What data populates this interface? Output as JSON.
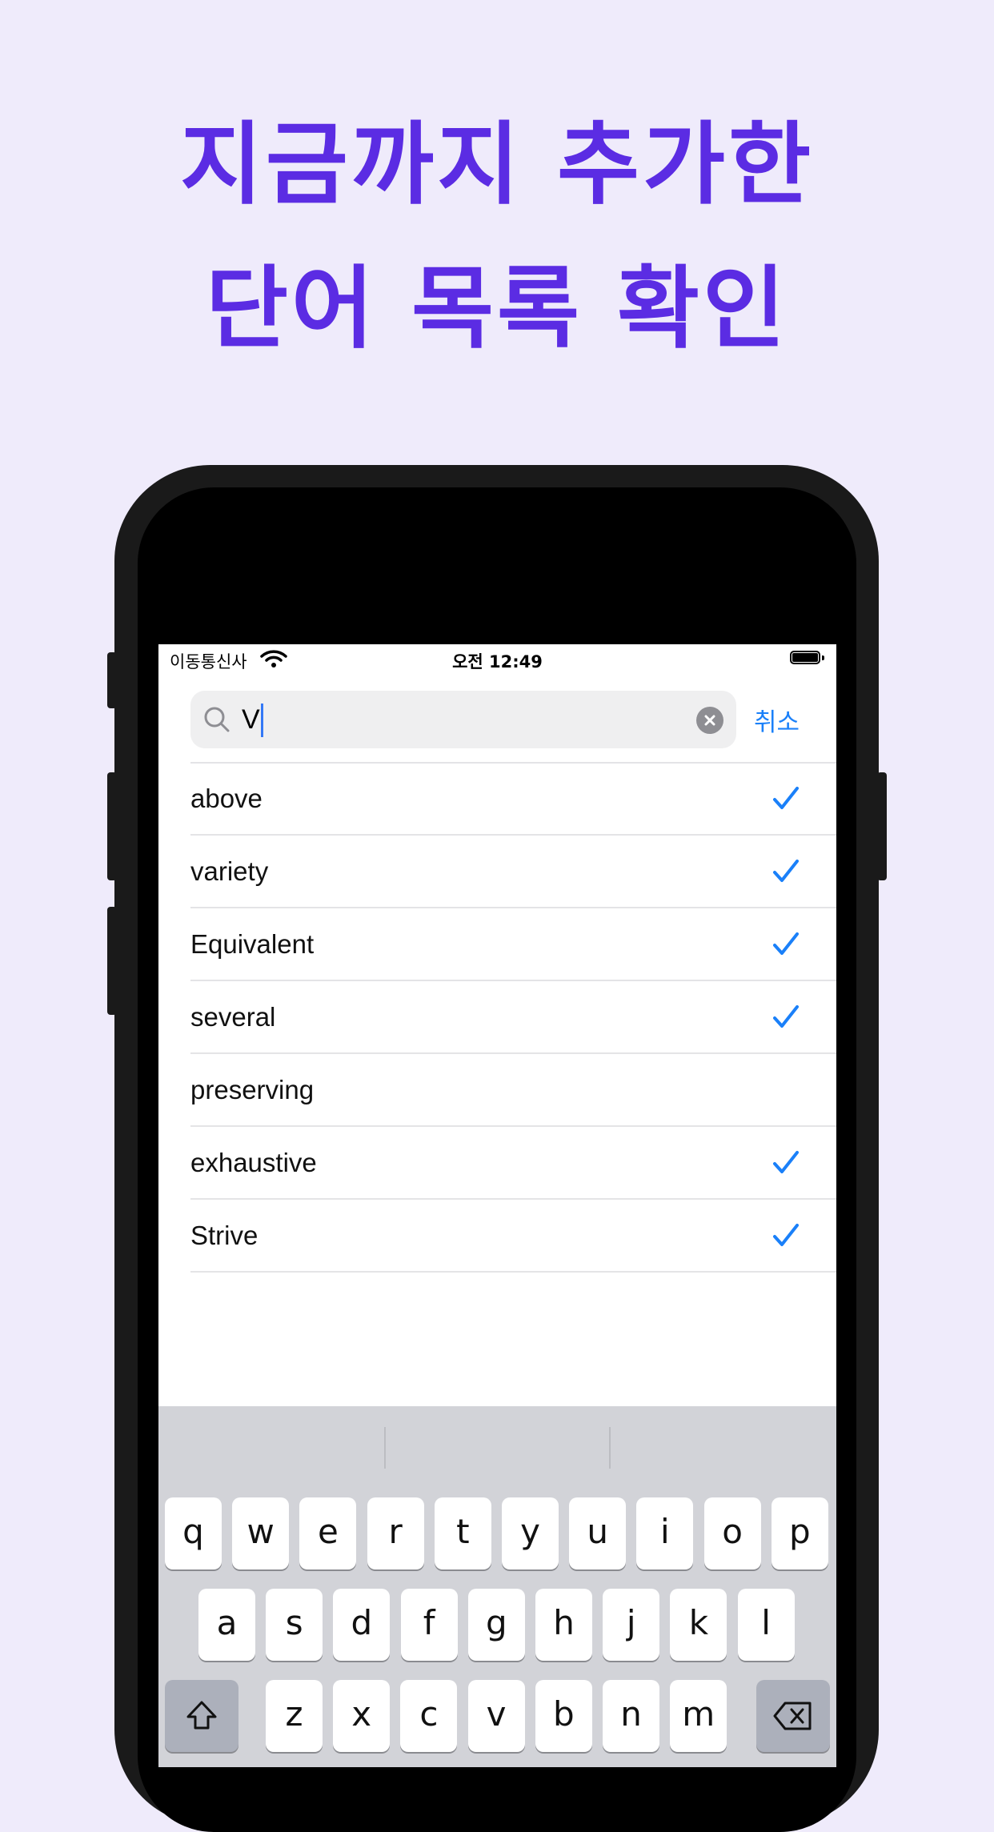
{
  "headline": {
    "line1": "지금까지 추가한",
    "line2": "단어 목록 확인"
  },
  "status_bar": {
    "carrier": "이동통신사",
    "time": "오전 12:49"
  },
  "search": {
    "value": "V",
    "cancel_label": "취소"
  },
  "words": [
    {
      "word": "above",
      "checked": true
    },
    {
      "word": "variety",
      "checked": true
    },
    {
      "word": "Equivalent",
      "checked": true
    },
    {
      "word": "several",
      "checked": true
    },
    {
      "word": "preserving",
      "checked": false
    },
    {
      "word": "exhaustive",
      "checked": true
    },
    {
      "word": "Strive",
      "checked": true
    }
  ],
  "keyboard": {
    "row1": [
      "q",
      "w",
      "e",
      "r",
      "t",
      "y",
      "u",
      "i",
      "o",
      "p"
    ],
    "row2": [
      "a",
      "s",
      "d",
      "f",
      "g",
      "h",
      "j",
      "k",
      "l"
    ],
    "row3": [
      "z",
      "x",
      "c",
      "v",
      "b",
      "n",
      "m"
    ]
  },
  "colors": {
    "accent": "#5b2ce3",
    "ios_blue": "#1a80f9",
    "background": "#efebfb"
  }
}
